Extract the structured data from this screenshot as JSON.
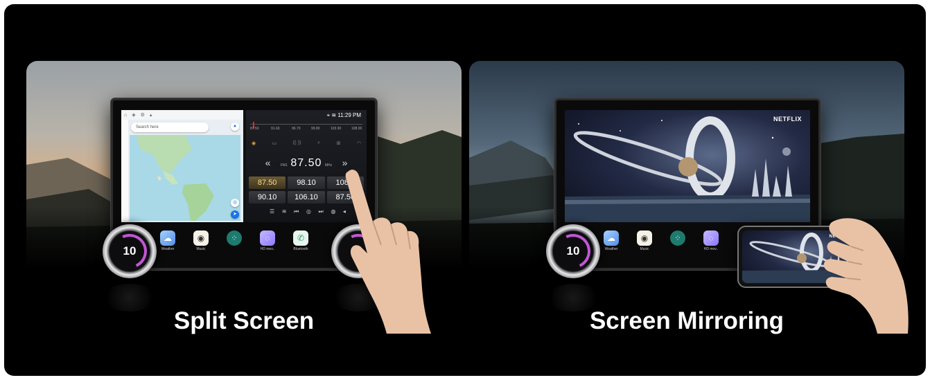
{
  "left_panel": {
    "caption": "Split Screen",
    "map": {
      "search_placeholder": "Search here"
    },
    "radio": {
      "status_time": "11:29 PM",
      "scale_labels": [
        "87.50",
        "91.60",
        "96.70",
        "99.80",
        "103.90",
        "108.00"
      ],
      "band": "FM1",
      "unit": "MHz",
      "frequency": "87.50",
      "presets": [
        "87.50",
        "98.10",
        "108.0",
        "90.10",
        "106.10",
        "87.50"
      ]
    },
    "knob_value": "10",
    "dock": [
      {
        "label": "Weather",
        "icon": "weather-icon"
      },
      {
        "label": "Music",
        "icon": "music-icon"
      },
      {
        "label": "",
        "icon": "apps-icon"
      },
      {
        "label": "HD mov..",
        "icon": "hd-movie-icon"
      },
      {
        "label": "Bluetooth",
        "icon": "bluetooth-icon"
      }
    ]
  },
  "right_panel": {
    "caption": "Screen Mirroring",
    "brand": "NETFLIX",
    "phone_brand": "NETFLIX",
    "knob_value": "10",
    "dock": [
      {
        "label": "Weather",
        "icon": "weather-icon"
      },
      {
        "label": "Music",
        "icon": "music-icon"
      },
      {
        "label": "",
        "icon": "apps-icon"
      },
      {
        "label": "HD mov..",
        "icon": "hd-movie-icon"
      }
    ]
  },
  "colors": {
    "background": "#000000",
    "knob_ring": "#c256d4",
    "preset_active": "#ffd88a"
  }
}
